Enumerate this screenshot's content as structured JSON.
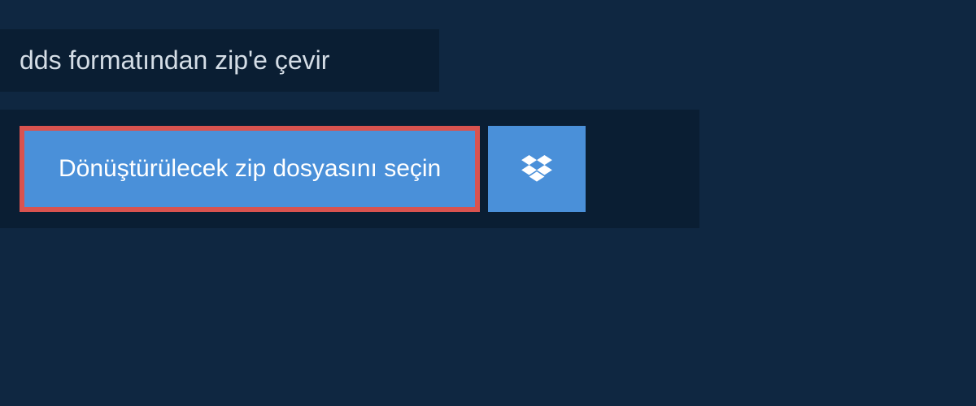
{
  "header": {
    "title": "dds formatından zip'e çevir"
  },
  "upload": {
    "select_file_label": "Dönüştürülecek zip dosyasını seçin",
    "dropbox_icon_name": "dropbox-icon"
  },
  "colors": {
    "background": "#0f2741",
    "panel": "#0a1e33",
    "button_primary": "#4a90d9",
    "highlight_border": "#d9534f",
    "text_light": "#d4dde6",
    "text_white": "#ffffff"
  }
}
